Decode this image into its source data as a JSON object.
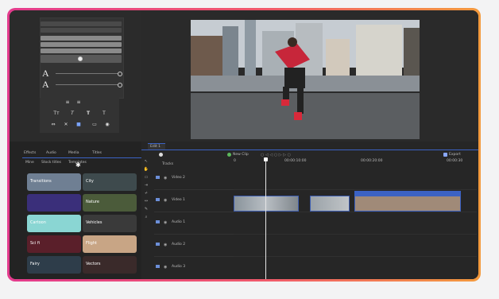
{
  "properties": {
    "text_size_label": "A",
    "leading_label": "A"
  },
  "text_tools": {
    "row1": [
      "≡",
      "≡"
    ],
    "row2": [
      "Tт",
      "T",
      "T",
      "T"
    ],
    "row3": [
      "⇔",
      "✕",
      "■",
      "▭",
      "◉"
    ]
  },
  "transitions_panel": {
    "tabs": [
      "Effects",
      "Audio",
      "Media",
      "Titles"
    ],
    "filters": [
      "Mine",
      "Stock titles",
      "Templates"
    ],
    "tiles": [
      {
        "label": "Transitions",
        "bg": "#6f7f93"
      },
      {
        "label": "City",
        "bg": "#3e4a4d"
      },
      {
        "label": "",
        "bg": "#3a2f7a"
      },
      {
        "label": "Nature",
        "bg": "#4b5b3a"
      },
      {
        "label": "Cartoon",
        "bg": "#8ad6d3"
      },
      {
        "label": "Vehicles",
        "bg": "#3a3a3a"
      },
      {
        "label": "Sci fi",
        "bg": "#5a1f2a"
      },
      {
        "label": "Flight",
        "bg": "#c8a585"
      },
      {
        "label": "Fairy",
        "bg": "#2e3d4a"
      },
      {
        "label": "Vectors",
        "bg": "#3a2a2a"
      }
    ]
  },
  "timeline": {
    "tab_label": "Edit 1",
    "new_clip_label": "New Clip",
    "export_label": "Export",
    "tracks_header": "Tracks",
    "timecodes": [
      "0",
      "00:00:10:00",
      "00:00:20:00",
      "00:00:30"
    ],
    "tracks": [
      "Video 2",
      "Video 1",
      "Audio 1",
      "Audio 2",
      "Audio 3"
    ]
  },
  "colors": {
    "accent": "#3b62c4",
    "bezel_start": "#e33b8d",
    "bezel_end": "#f39a3d"
  }
}
